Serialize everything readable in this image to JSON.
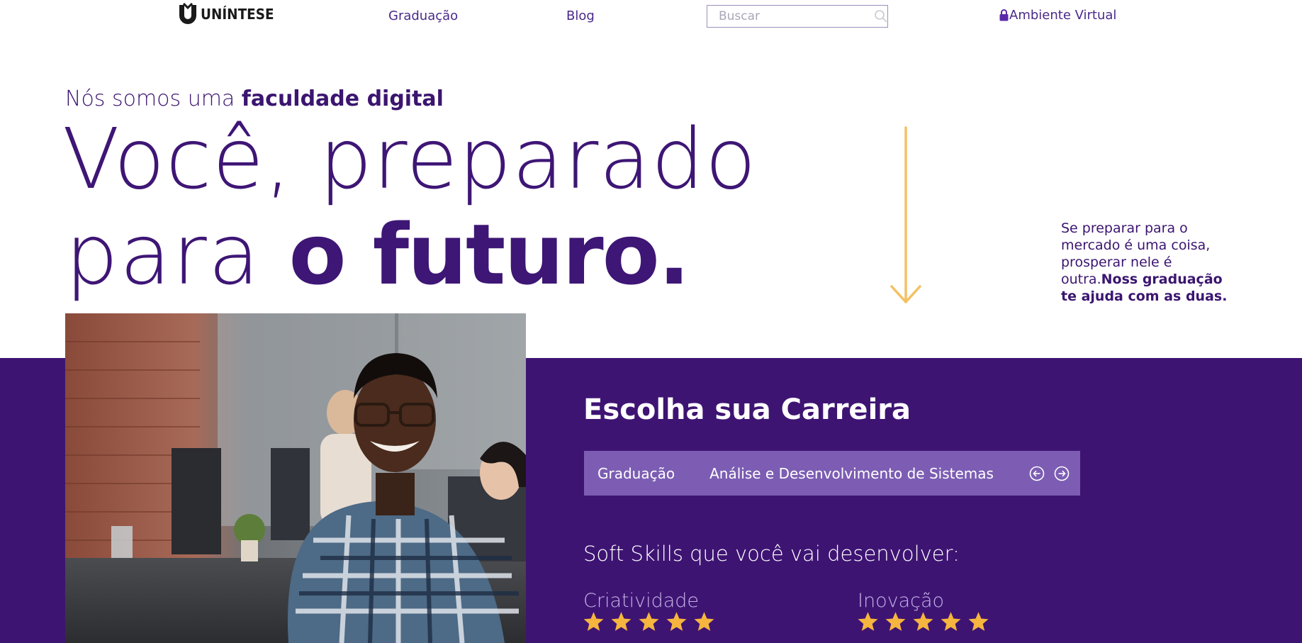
{
  "nav": {
    "logo_text": "UNÍNTESE",
    "links": [
      "Graduação",
      "Blog"
    ],
    "search_placeholder": "Buscar",
    "search_icon": "search-icon",
    "virtual_env_label": "Ambiente Virtual",
    "virtual_env_icon": "lock-icon"
  },
  "hero": {
    "subtitle_prefix": "Nós somos uma ",
    "subtitle_bold": "faculdade digital",
    "line1": "Você, preparado",
    "line2_prefix": "para ",
    "line2_bold": "o futuro.",
    "side_text_prefix": "Se preparar para o mercado é uma coisa, prosperar nele é outra.",
    "side_text_bold": "Noss graduação te ajuda com as duas.",
    "arrow_icon": "arrow-down-icon"
  },
  "career": {
    "title": "Escolha sua Carreira",
    "category": "Graduação",
    "course": "Análise e Desenvolvimento de Sistemas",
    "prev_icon": "arrow-left-circle-icon",
    "next_icon": "arrow-right-circle-icon"
  },
  "skills": {
    "title": "Soft Skills que você vai desenvolver:",
    "items": [
      {
        "name": "Criatividade",
        "stars": 5,
        "max": 5
      },
      {
        "name": "Inovação",
        "stars": 5,
        "max": 5
      }
    ]
  },
  "colors": {
    "brand_purple": "#3e1473",
    "bar_purple": "#7c5db3",
    "star_gold": "#f5b53f",
    "arrow_gold": "#f4c063"
  }
}
